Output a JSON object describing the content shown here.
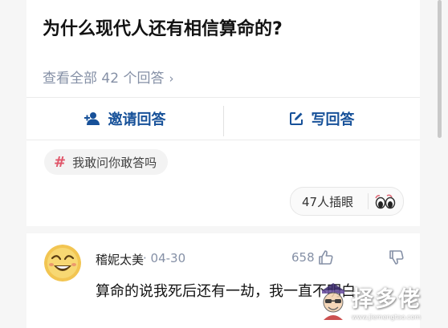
{
  "question": {
    "title": "为什么现代人还有相信算命的?",
    "view_all": "查看全部 42 个回答",
    "view_all_chevron_icon": "chevron-right-icon"
  },
  "actions": {
    "invite_label": "邀请回答",
    "invite_icon": "add-user-icon",
    "write_label": "写回答",
    "write_icon": "edit-icon",
    "accent_color": "#175199"
  },
  "topic": {
    "hash": "#",
    "label": "我敢问你敢答吗",
    "hash_color": "#e0566a"
  },
  "reaction": {
    "label": "47人插眼",
    "icon": "eyes-icon"
  },
  "answer": {
    "author": "稽妮太美",
    "date": "· 04-30",
    "upvotes": "658",
    "upvote_icon": "thumbs-up-icon",
    "downvote_icon": "thumbs-down-icon",
    "text": "算命的说我死后还有一劫，我一直不明白"
  },
  "watermark": {
    "text": "择多佬",
    "url": "www.jiemengtao.com"
  }
}
